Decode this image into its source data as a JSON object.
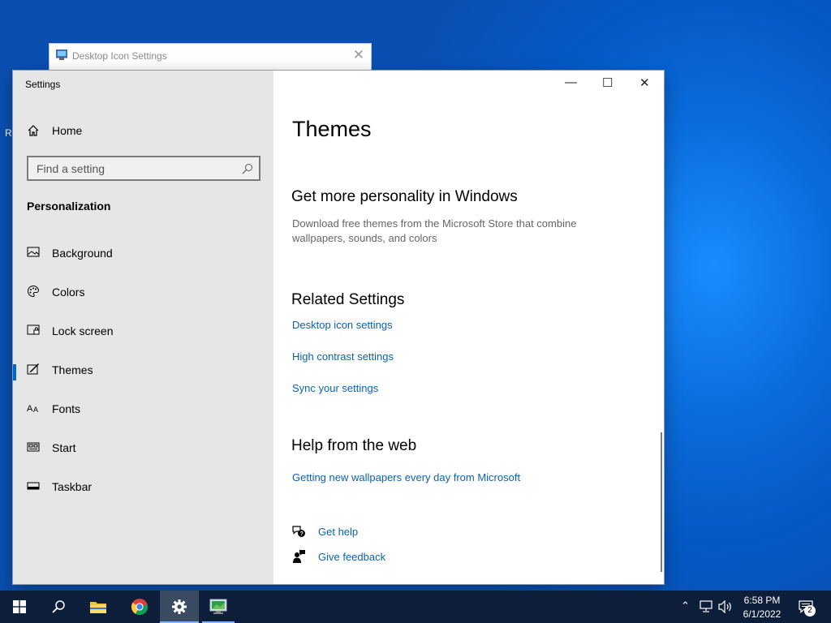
{
  "desktop": {
    "edge_text": "R"
  },
  "background_window": {
    "title": "Desktop Icon Settings",
    "close_glyph": "✕"
  },
  "settings": {
    "app_title": "Settings",
    "controls": {
      "minimize": "—",
      "maximize": "☐",
      "close": "✕"
    },
    "sidebar": {
      "home_label": "Home",
      "search_placeholder": "Find a setting",
      "section_title": "Personalization",
      "items": [
        {
          "label": "Background",
          "icon": "picture-icon"
        },
        {
          "label": "Colors",
          "icon": "palette-icon"
        },
        {
          "label": "Lock screen",
          "icon": "lock-screen-icon"
        },
        {
          "label": "Themes",
          "icon": "themes-icon",
          "selected": true
        },
        {
          "label": "Fonts",
          "icon": "fonts-icon"
        },
        {
          "label": "Start",
          "icon": "start-icon"
        },
        {
          "label": "Taskbar",
          "icon": "taskbar-icon"
        }
      ]
    },
    "main": {
      "page_title": "Themes",
      "personality": {
        "heading": "Get more personality in Windows",
        "description": "Download free themes from the Microsoft Store that combine wallpapers, sounds, and colors"
      },
      "related": {
        "heading": "Related Settings",
        "links": [
          "Desktop icon settings",
          "High contrast settings",
          "Sync your settings"
        ]
      },
      "help_web": {
        "heading": "Help from the web",
        "link": "Getting new wallpapers every day from Microsoft"
      },
      "get_help": "Get help",
      "give_feedback": "Give feedback"
    }
  },
  "taskbar": {
    "apps": [
      "start-button",
      "search",
      "file-explorer",
      "chrome",
      "settings",
      "desktop-icon-settings"
    ],
    "active_app": "settings",
    "clock_time": "6:58 PM",
    "clock_date": "6/1/2022",
    "notification_count": "2"
  },
  "colors": {
    "accent": "#0067c0",
    "link": "#0b63ae",
    "sidebar_bg": "#e6e6e6",
    "taskbar_bg": "#0d1e3a"
  }
}
